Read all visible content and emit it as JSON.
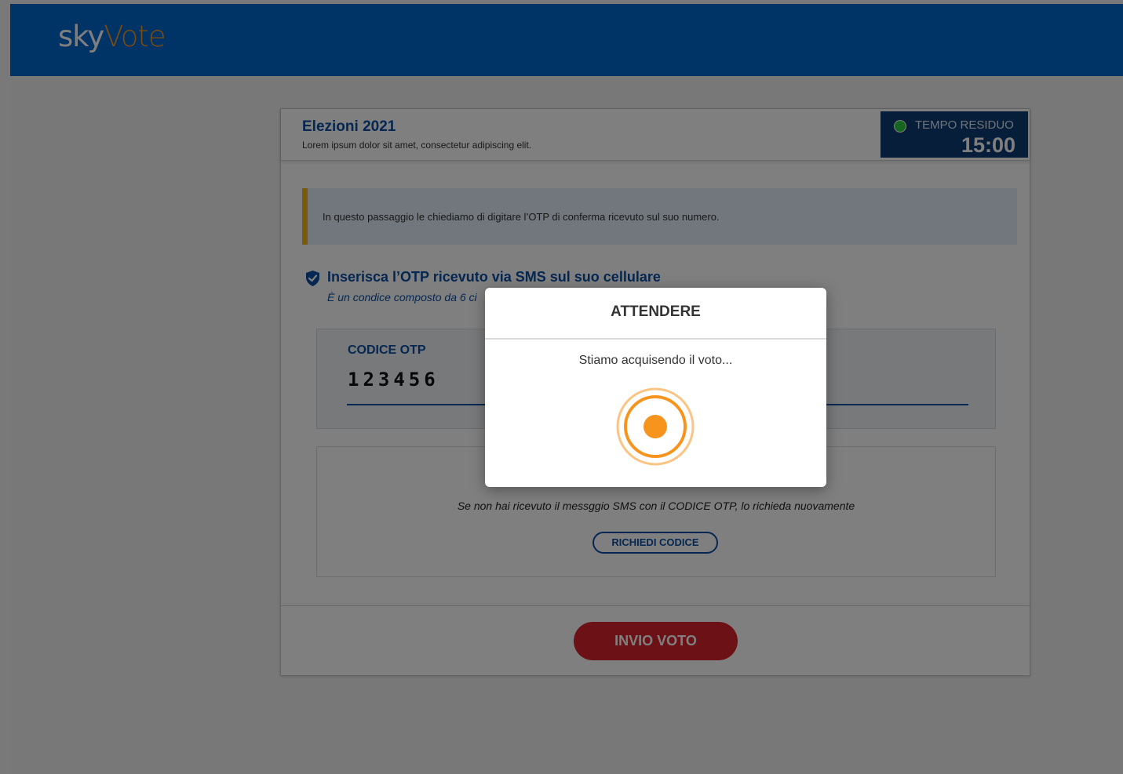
{
  "brand": {
    "logo_prefix": "sky",
    "logo_suffix": "Vote",
    "accent": "#f7941d",
    "header_color": "#0066cc"
  },
  "election": {
    "title": "Elezioni 2021",
    "subtitle": "Lorem ipsum dolor sit amet, consectetur adipiscing elit."
  },
  "timer": {
    "label": "TEMPO RESIDUO",
    "value": "15:00",
    "status_color": "#2ecc40"
  },
  "info": {
    "text": "In questo passaggio le chiediamo di digitare l’OTP  di conferma ricevuto sul suo numero."
  },
  "otp_section": {
    "title": "Inserisca l’OTP ricevuto via SMS  sul suo cellulare",
    "subtitle": "È un condice composto da 6 ci",
    "icon": "shield-check-icon",
    "field_label": "CODICE OTP",
    "field_value": "123456"
  },
  "resend": {
    "text": "Se non hai ricevuto il messggio SMS con il CODICE OTP, lo richieda nuovamente",
    "button_label": "RICHIEDI CODICE"
  },
  "submit": {
    "label": "INVIO VOTO",
    "color": "#d8222a"
  },
  "modal": {
    "title": "ATTENDERE",
    "message": "Stiamo acquisendo il voto...",
    "icon": "loading-spinner-icon",
    "spinner_color": "#f7941d"
  }
}
